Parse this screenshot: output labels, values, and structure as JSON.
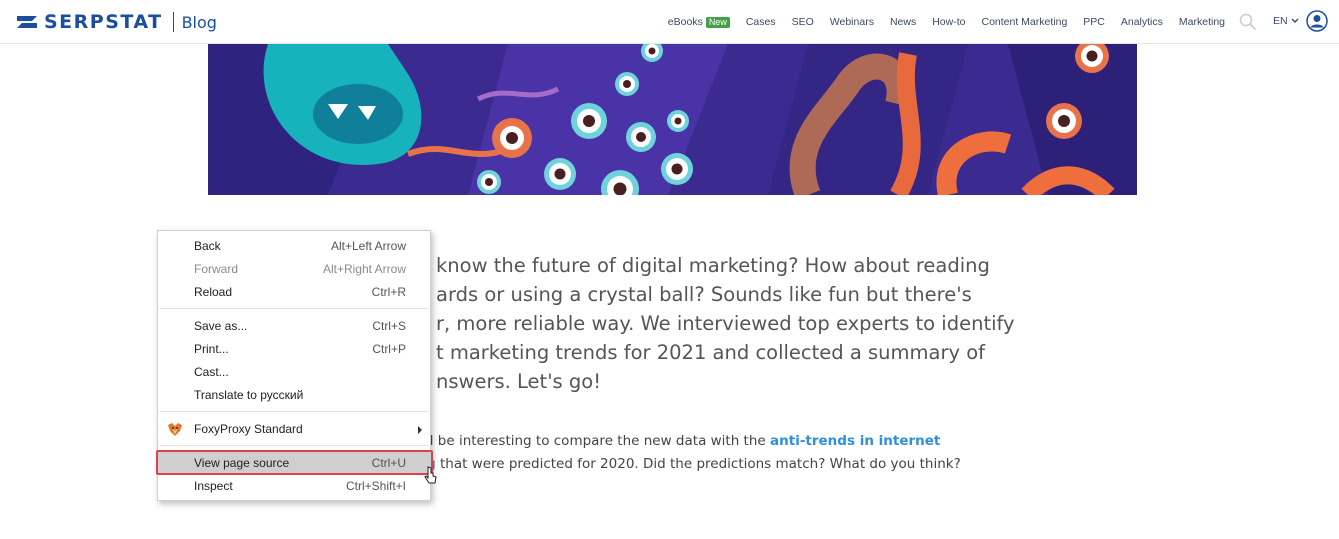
{
  "header": {
    "logo_text": "SERPSTAT",
    "logo_sub": "Blog",
    "nav": [
      {
        "label": "eBooks",
        "badge": "New"
      },
      {
        "label": "Cases"
      },
      {
        "label": "SEO"
      },
      {
        "label": "Webinars"
      },
      {
        "label": "News"
      },
      {
        "label": "How-to"
      },
      {
        "label": "Content Marketing"
      },
      {
        "label": "PPC"
      },
      {
        "label": "Analytics"
      },
      {
        "label": "Marketing"
      }
    ],
    "language": "EN"
  },
  "article": {
    "intro_lines": [
      "know the future of digital marketing? How about reading",
      "ards or using a crystal ball? Sounds like fun but there's",
      "r, more reliable way. We interviewed top experts to identify",
      "t marketing trends for 2021 and collected a summary of",
      "nswers. Let's go!"
    ],
    "para2_line1_prefix": "ll be interesting to compare the new data with the ",
    "para2_link1": "anti-trends in internet",
    "para2_link2": "g",
    "para2_line2_suffix": " that were predicted for 2020. Did the predictions match? What do you think?"
  },
  "context_menu": {
    "items": [
      {
        "label": "Back",
        "shortcut": "Alt+Left Arrow"
      },
      {
        "label": "Forward",
        "shortcut": "Alt+Right Arrow",
        "disabled": true
      },
      {
        "label": "Reload",
        "shortcut": "Ctrl+R"
      },
      {
        "label": "Save as...",
        "shortcut": "Ctrl+S"
      },
      {
        "label": "Print...",
        "shortcut": "Ctrl+P"
      },
      {
        "label": "Cast..."
      },
      {
        "label": "Translate to русский"
      },
      {
        "label": "FoxyProxy Standard",
        "icon": "foxyproxy-icon",
        "submenu": true
      },
      {
        "label": "View page source",
        "shortcut": "Ctrl+U",
        "highlighted": true
      },
      {
        "label": "Inspect",
        "shortcut": "Ctrl+Shift+I"
      }
    ]
  },
  "colors": {
    "brand": "#1b4f9e",
    "link": "#2f8fdc",
    "badge": "#43a047",
    "highlight_outline": "#d9434b",
    "hero_bg": "#3b2a8f"
  }
}
